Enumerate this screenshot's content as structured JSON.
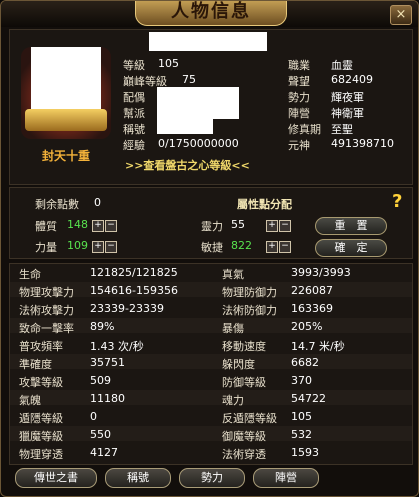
{
  "window": {
    "title": "人物信息",
    "close_glyph": "×"
  },
  "portrait": {
    "title": "封天十重"
  },
  "profile_left": [
    {
      "label": "等級",
      "value": "105"
    },
    {
      "label": "巔峰等級",
      "value": "75"
    },
    {
      "label": "配偶",
      "value": ""
    },
    {
      "label": "幫派",
      "value": ""
    },
    {
      "label": "稱號",
      "value": ""
    },
    {
      "label": "經驗",
      "value": "0/1750000000"
    }
  ],
  "profile_right": [
    {
      "label": "職業",
      "value": "血靈"
    },
    {
      "label": "聲望",
      "value": "682409"
    },
    {
      "label": "勢力",
      "value": "輝夜軍"
    },
    {
      "label": "陣營",
      "value": "神衛軍"
    },
    {
      "label": "修真期",
      "value": "至聖"
    },
    {
      "label": "元神",
      "value": "491398710"
    }
  ],
  "link": ">>查看盤古之心等級<<",
  "points": {
    "remaining_label": "剩余點數",
    "remaining_value": "0",
    "allocate_title": "屬性點分配",
    "stats": [
      {
        "label": "體質",
        "value": "148"
      },
      {
        "label": "靈力",
        "value": "55"
      },
      {
        "label": "力量",
        "value": "109"
      },
      {
        "label": "敏捷",
        "value": "822"
      }
    ],
    "plus": "+",
    "minus": "−",
    "reset": "重　置",
    "confirm": "確　定",
    "help": "?"
  },
  "stats_left": [
    {
      "label": "生命",
      "value": "121825/121825"
    },
    {
      "label": "物理攻擊力",
      "value": "154616-159356"
    },
    {
      "label": "法術攻擊力",
      "value": "23339-23339"
    },
    {
      "label": "致命一擊率",
      "value": "89%"
    },
    {
      "label": "普攻頻率",
      "value": "1.43 次/秒"
    },
    {
      "label": "準確度",
      "value": "35751"
    },
    {
      "label": "攻擊等級",
      "value": "509"
    },
    {
      "label": "氣魄",
      "value": "11180"
    },
    {
      "label": "遁隱等級",
      "value": "0"
    },
    {
      "label": "獵魔等級",
      "value": "550"
    },
    {
      "label": "物理穿透",
      "value": "4127"
    }
  ],
  "stats_right": [
    {
      "label": "真氣",
      "value": "3993/3993"
    },
    {
      "label": "物理防御力",
      "value": "226087"
    },
    {
      "label": "法術防御力",
      "value": "163369"
    },
    {
      "label": "暴傷",
      "value": "205%"
    },
    {
      "label": "移動速度",
      "value": "14.7 米/秒"
    },
    {
      "label": "躲閃度",
      "value": "6682"
    },
    {
      "label": "防御等級",
      "value": "370"
    },
    {
      "label": "魂力",
      "value": "54722"
    },
    {
      "label": "反遁隱等級",
      "value": "105"
    },
    {
      "label": "御魔等級",
      "value": "532"
    },
    {
      "label": "法術穿透",
      "value": "1593"
    }
  ],
  "buttons": [
    "傳世之書",
    "稱號",
    "勢力",
    "陣營"
  ]
}
